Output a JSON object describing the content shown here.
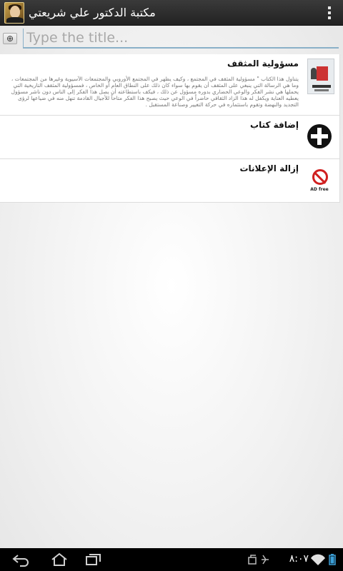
{
  "app": {
    "title": "مكتبة الدكتور علي شريعتي",
    "icon": "author-portrait-icon"
  },
  "title_input": {
    "placeholder": "Type the title...",
    "value": ""
  },
  "books": [
    {
      "title": "مسؤولية المثقف",
      "description": "يتناول هذا الكتاب \" مسؤولية المثقف في المجتمع ، وكيف يظهر في المجتمع الأوروبي والمجتمعات الآسيوية وغيرها من المجتمعات ، وما هي الرسالة التي ينبغي على المثقف أن يقوم بها سواء كان ذلك على النطاق العام أو الخاص ، فمسؤولية المثقف التاريخية التي يحملها هي نشر الفكر والوعي الحضاري بدوره مسؤول عن ذلك ، فيكف باستطاعته أن يصل هذا الفكر إلى الناس دون ناشر مسؤول يعطيه العناية ويكفل له هذا الزاد الثقافي حاضراً في الوعي حيث يصبح هذا الفكر متاحاً للأجيال القادمة تنهل منه في ضياعها لرؤى التجديد والنهضة وتقوم باستثماره في حركة التغيير وصناعة المستقبل ."
    }
  ],
  "actions": {
    "add_book": "إضافة كتاب",
    "remove_ads": "إزالة الإعلانات",
    "ad_free_label": "AD free"
  },
  "status_bar": {
    "time": "٨:٠٧"
  },
  "colors": {
    "action_bar": "#2b2b2b",
    "input_underline": "#8ab0c8",
    "adfree_red": "#d02020"
  }
}
